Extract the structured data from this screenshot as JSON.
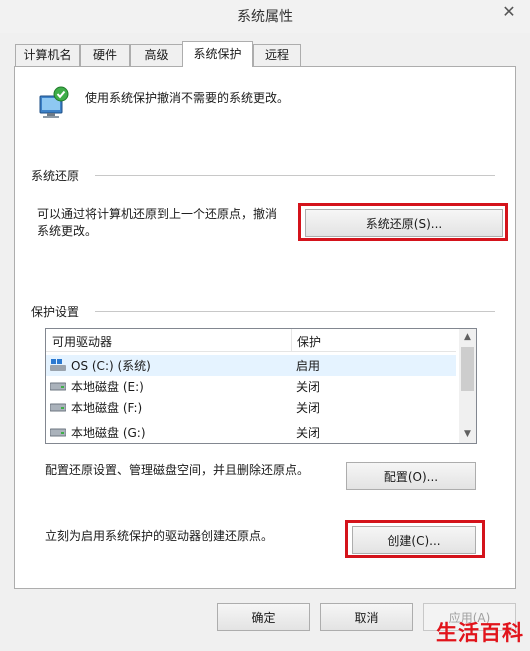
{
  "window": {
    "title": "系统属性"
  },
  "tabs": [
    {
      "label": "计算机名",
      "active": false
    },
    {
      "label": "硬件",
      "active": false
    },
    {
      "label": "高级",
      "active": false
    },
    {
      "label": "系统保护",
      "active": true
    },
    {
      "label": "远程",
      "active": false
    }
  ],
  "header": {
    "text": "使用系统保护撤消不需要的系统更改。"
  },
  "restore": {
    "group_label": "系统还原",
    "description_line1": "可以通过将计算机还原到上一个还原点，撤消",
    "description_line2": "系统更改。",
    "button_label": "系统还原(S)..."
  },
  "protection": {
    "group_label": "保护设置",
    "columns": [
      "可用驱动器",
      "保护"
    ],
    "drives": [
      {
        "name": "OS (C:) (系统)",
        "status": "启用",
        "icon": "system-drive-icon"
      },
      {
        "name": "本地磁盘 (E:)",
        "status": "关闭",
        "icon": "hard-drive-icon"
      },
      {
        "name": "本地磁盘 (F:)",
        "status": "关闭",
        "icon": "hard-drive-icon"
      },
      {
        "name": "本地磁盘 (G:)",
        "status": "关闭",
        "icon": "hard-drive-icon"
      }
    ],
    "configure_text": "配置还原设置、管理磁盘空间，并且删除还原点。",
    "configure_button": "配置(O)...",
    "create_text": "立刻为启用系统保护的驱动器创建还原点。",
    "create_button": "创建(C)..."
  },
  "footer": {
    "ok": "确定",
    "cancel": "取消",
    "apply": "应用(A)"
  },
  "watermark": "生活百科",
  "colors": {
    "highlight": "#d4131b",
    "watermark": "#e1141b",
    "selected_row": "#e5f3ff"
  }
}
